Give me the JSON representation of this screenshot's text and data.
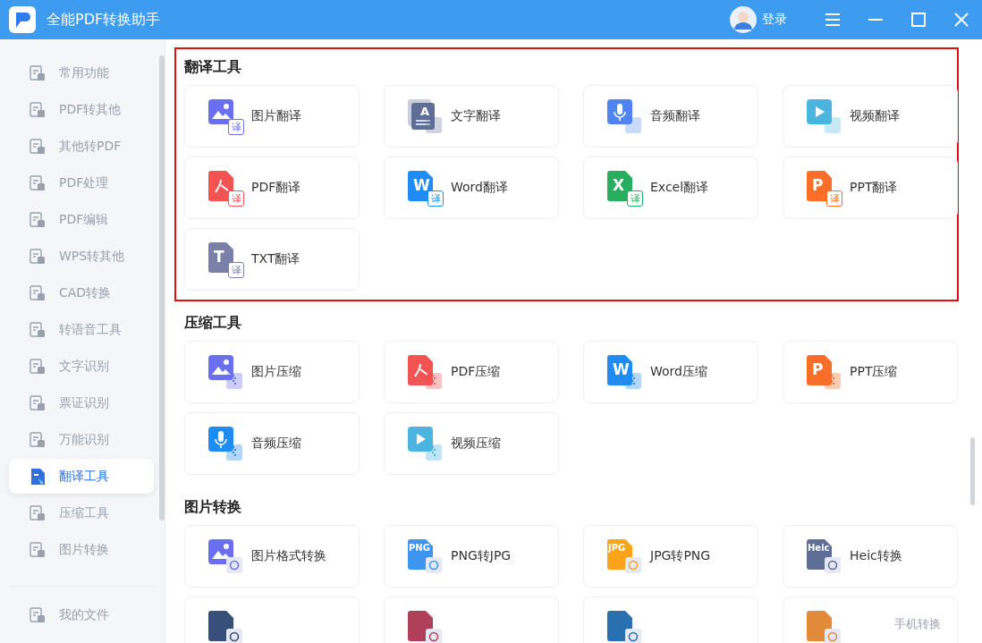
{
  "window": {
    "title": "全能PDF转换助手",
    "login": "登录"
  },
  "sidebar": {
    "items": [
      {
        "label": "常用功能",
        "selected": false
      },
      {
        "label": "PDF转其他",
        "selected": false
      },
      {
        "label": "其他转PDF",
        "selected": false
      },
      {
        "label": "PDF处理",
        "selected": false
      },
      {
        "label": "PDF编辑",
        "selected": false
      },
      {
        "label": "WPS转其他",
        "selected": false
      },
      {
        "label": "CAD转换",
        "selected": false
      },
      {
        "label": "转语音工具",
        "selected": false
      },
      {
        "label": "文字识别",
        "selected": false
      },
      {
        "label": "票证识别",
        "selected": false
      },
      {
        "label": "万能识别",
        "selected": false
      },
      {
        "label": "翻译工具",
        "selected": true
      },
      {
        "label": "压缩工具",
        "selected": false
      },
      {
        "label": "图片转换",
        "selected": false
      }
    ],
    "footer_item": {
      "label": "我的文件"
    }
  },
  "sections": [
    {
      "title": "翻译工具",
      "kind": "translate",
      "highlighted": true,
      "tiles": [
        {
          "label": "图片翻译",
          "kind": "image",
          "color": "#6a6ff0",
          "badge": "译"
        },
        {
          "label": "文字翻译",
          "kind": "doc",
          "color": "#5f6e96",
          "icon_text": "A"
        },
        {
          "label": "音频翻译",
          "kind": "audio",
          "color": "#4f84f0"
        },
        {
          "label": "视频翻译",
          "kind": "video",
          "color": "#4bb5e0"
        },
        {
          "label": "PDF翻译",
          "kind": "pdf",
          "color": "#f25454",
          "badge": "译"
        },
        {
          "label": "Word翻译",
          "kind": "word",
          "color": "#1f8cf5",
          "icon_text": "W",
          "badge": "译"
        },
        {
          "label": "Excel翻译",
          "kind": "excel",
          "color": "#27ae5f",
          "icon_text": "X",
          "badge": "译"
        },
        {
          "label": "PPT翻译",
          "kind": "ppt",
          "color": "#fa6e2a",
          "icon_text": "P",
          "badge": "译"
        },
        {
          "label": "TXT翻译",
          "kind": "txt",
          "color": "#7a80a8",
          "icon_text": "T",
          "badge": "译"
        }
      ]
    },
    {
      "title": "压缩工具",
      "kind": "compress",
      "highlighted": false,
      "tiles": [
        {
          "label": "图片压缩",
          "kind": "image",
          "color": "#6a6ff0"
        },
        {
          "label": "PDF压缩",
          "kind": "pdf",
          "color": "#f25454"
        },
        {
          "label": "Word压缩",
          "kind": "word",
          "color": "#1f8cf5",
          "icon_text": "W"
        },
        {
          "label": "PPT压缩",
          "kind": "ppt",
          "color": "#fa6e2a",
          "icon_text": "P"
        },
        {
          "label": "音频压缩",
          "kind": "audio",
          "color": "#1f8cf5"
        },
        {
          "label": "视频压缩",
          "kind": "video",
          "color": "#4bb5e0"
        }
      ]
    },
    {
      "title": "图片转换",
      "kind": "convert",
      "highlighted": false,
      "tiles": [
        {
          "label": "图片格式转换",
          "kind": "image",
          "color": "#6a6ff0"
        },
        {
          "label": "PNG转JPG",
          "kind": "tag",
          "color": "#3d95f0",
          "icon_text": "PNG"
        },
        {
          "label": "JPG转PNG",
          "kind": "tag",
          "color": "#fba31a",
          "icon_text": "JPG"
        },
        {
          "label": "Heic转换",
          "kind": "tag",
          "color": "#5f6e96",
          "icon_text": "Heic"
        },
        {
          "kind": "tag",
          "color": "#37507a"
        },
        {
          "kind": "tag",
          "color": "#b0405a"
        },
        {
          "kind": "tag",
          "color": "#2a6fb0"
        },
        {
          "kind": "tag",
          "color": "#e08a3a"
        }
      ]
    }
  ],
  "floating_link": "手机转换"
}
